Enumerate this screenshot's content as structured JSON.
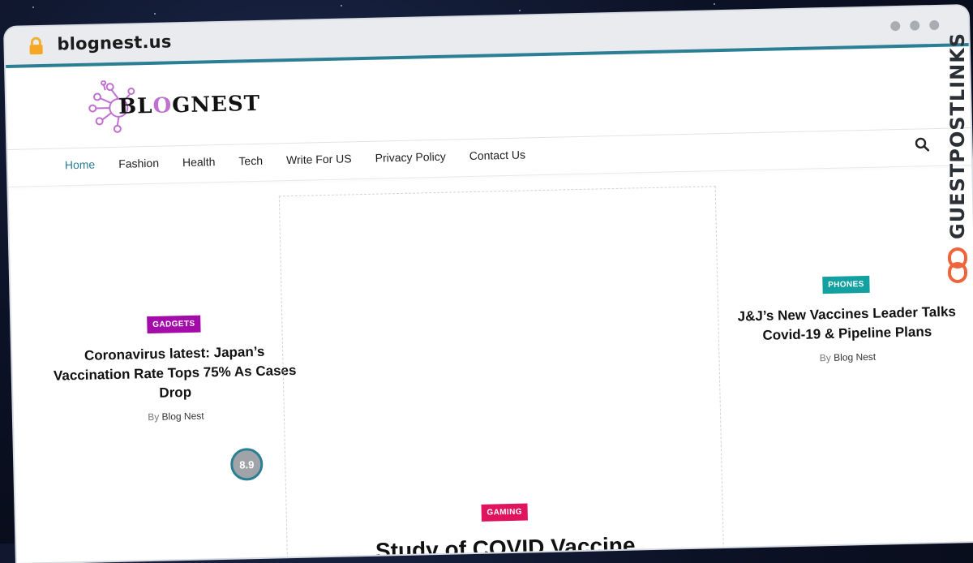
{
  "browser": {
    "url": "blognest.us"
  },
  "site": {
    "logo_text_parts": [
      "BL",
      "O",
      "GNEST"
    ]
  },
  "nav": {
    "items": [
      "Home",
      "Fashion",
      "Health",
      "Tech",
      "Write For US",
      "Privacy Policy",
      "Contact Us"
    ],
    "active": "Home"
  },
  "posts": {
    "left": {
      "category": "GADGETS",
      "category_color": "#a30ca8",
      "title": "Coronavirus latest: Japan’s Vaccination Rate Tops 75% As Cases Drop",
      "by": "By",
      "author": "Blog Nest",
      "score": "8.9"
    },
    "center": {
      "category": "GAMING",
      "category_color": "#e0135e",
      "title": "Study of COVID Vaccine"
    },
    "right": {
      "category": "PHONES",
      "category_color": "#13a0a0",
      "title": "J&J’s New Vaccines Leader Talks Covid-19 & Pipeline Plans",
      "by": "By",
      "author": "Blog Nest"
    }
  },
  "side_brand": {
    "text": "GUESTPOSTLINKS"
  },
  "colors": {
    "accent": "#2a7f95",
    "logo_purple": "#c070d0"
  }
}
